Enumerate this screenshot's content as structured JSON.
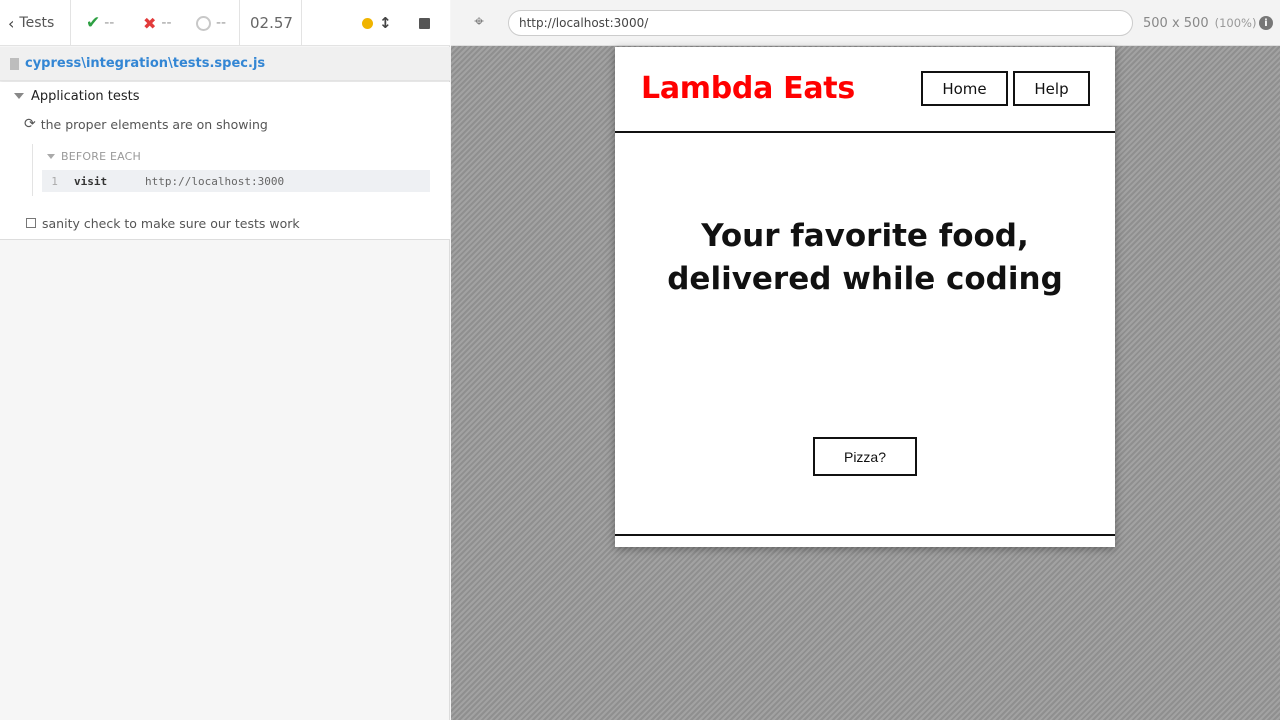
{
  "reporter": {
    "stats": {
      "tests_label": "Tests",
      "passed": "--",
      "failed": "--",
      "pending": "--",
      "duration": "02.57",
      "scroll_icon": "↕"
    },
    "spec_file": "cypress\\integration\\tests.spec.js",
    "suite": {
      "title": "Application tests",
      "tests": [
        {
          "title": "the proper elements are on showing",
          "state": "running"
        },
        {
          "title": "sanity check to make sure our tests work",
          "state": "not-run"
        }
      ],
      "hook": {
        "title": "BEFORE EACH",
        "commands": [
          {
            "number": "1",
            "name": "visit",
            "message": "http://localhost:3000"
          }
        ]
      }
    }
  },
  "aut": {
    "url": "http://localhost:3000/",
    "viewport": "500 x 500",
    "zoom": "(100%)",
    "app": {
      "brand": "Lambda Eats",
      "nav": {
        "home": "Home",
        "help": "Help"
      },
      "hero": "Your favorite food, delivered while coding",
      "cta": "Pizza?"
    }
  },
  "colors": {
    "brand": "#ff0000",
    "pass": "#2ea043",
    "fail": "#e23b3b",
    "running": "#f0b400",
    "link": "#3386d4"
  }
}
